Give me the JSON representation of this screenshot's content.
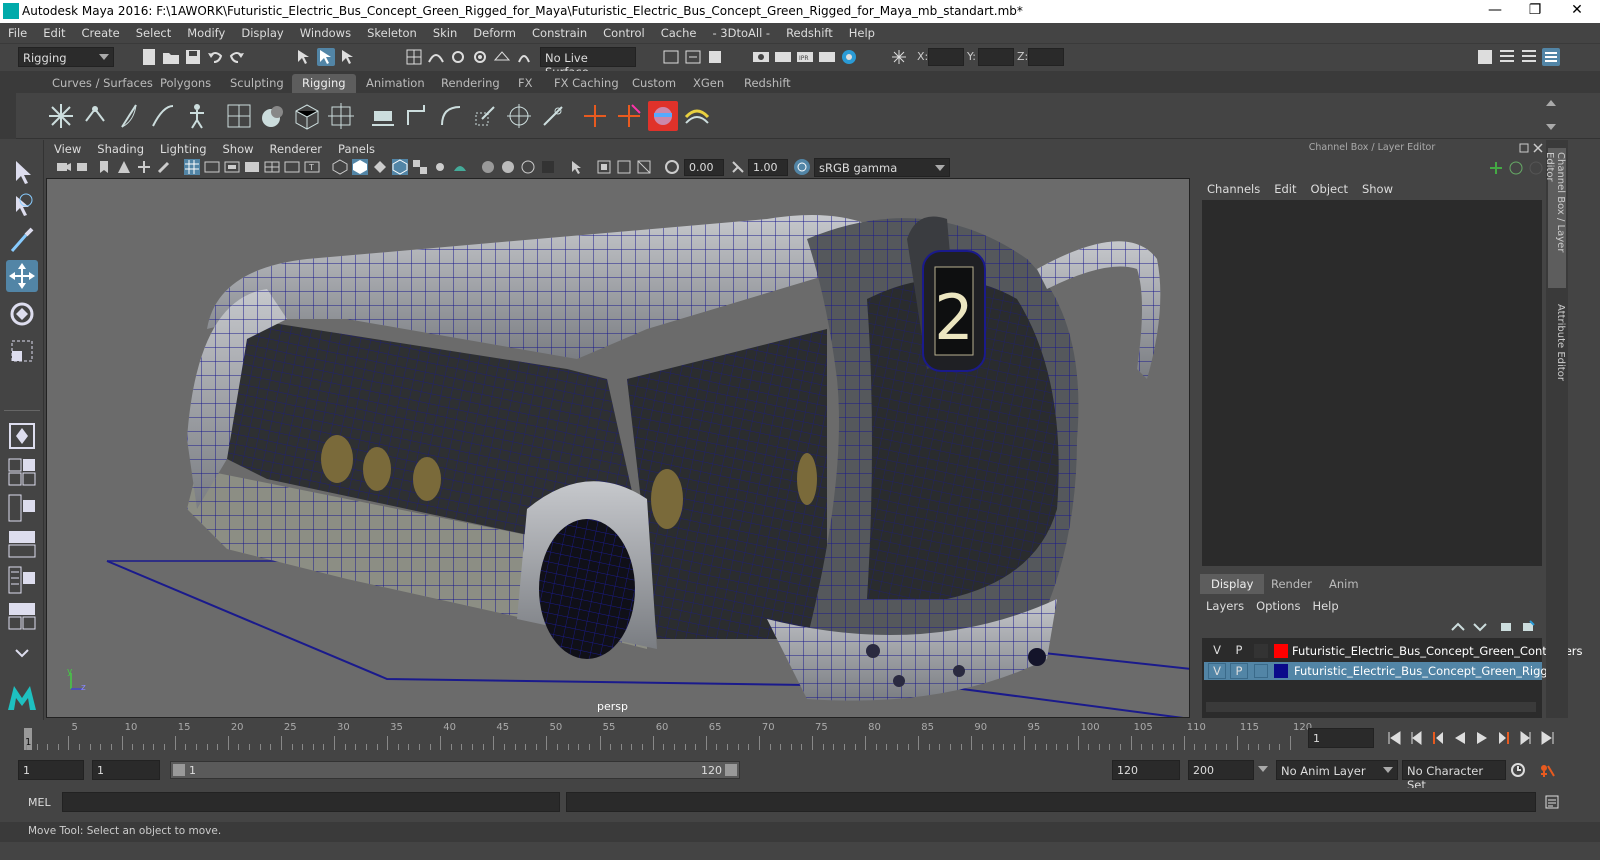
{
  "window": {
    "title": "Autodesk Maya 2016: F:\\1AWORK\\Futuristic_Electric_Bus_Concept_Green_Rigged_for_Maya\\Futuristic_Electric_Bus_Concept_Green_Rigged_for_Maya_mb_standart.mb*",
    "minimize": "—",
    "restore": "❐",
    "close": "✕"
  },
  "menubar": [
    "File",
    "Edit",
    "Create",
    "Select",
    "Modify",
    "Display",
    "Windows",
    "Skeleton",
    "Skin",
    "Deform",
    "Constrain",
    "Control",
    "Cache",
    "- 3DtoAll -",
    "Redshift",
    "Help"
  ],
  "statusline": {
    "mode": "Rigging",
    "live_surface": "No Live Surface",
    "x_label": "X:",
    "y_label": "Y:",
    "z_label": "Z:"
  },
  "shelf_tabs": [
    "Curves / Surfaces",
    "Polygons",
    "Sculpting",
    "Rigging",
    "Animation",
    "Rendering",
    "FX",
    "FX Caching",
    "Custom",
    "XGen",
    "Redshift"
  ],
  "shelf_active": "Rigging",
  "viewport": {
    "menu": [
      "View",
      "Shading",
      "Lighting",
      "Show",
      "Renderer",
      "Panels"
    ],
    "exposure": "0.00",
    "gamma": "1.00",
    "color_space": "sRGB gamma",
    "camera": "persp",
    "bus_number": "2",
    "axis_y": "y",
    "axis_z": "z"
  },
  "channel_box": {
    "title": "Channel Box / Layer Editor",
    "menu": [
      "Channels",
      "Edit",
      "Object",
      "Show"
    ],
    "layer_tabs": [
      "Display",
      "Render",
      "Anim"
    ],
    "layer_menu": [
      "Layers",
      "Options",
      "Help"
    ],
    "layers": [
      {
        "v": "V",
        "p": "P",
        "color": "#ff0000",
        "name": "Futuristic_Electric_Bus_Concept_Green_Controllers"
      },
      {
        "v": "V",
        "p": "P",
        "color": "#0a0a8a",
        "name": "Futuristic_Electric_Bus_Concept_Green_Rigged"
      }
    ],
    "side_tabs": [
      "Channel Box / Layer Editor",
      "Attribute Editor"
    ]
  },
  "timeline": {
    "ticks": [
      5,
      10,
      15,
      20,
      25,
      30,
      35,
      40,
      45,
      50,
      55,
      60,
      65,
      70,
      75,
      80,
      85,
      90,
      95,
      100,
      105,
      110,
      115,
      120
    ],
    "current_frame_marker": "1",
    "current_frame": "1"
  },
  "range": {
    "start": "1",
    "playback_start": "1",
    "range_start_label": "1",
    "range_end_label": "120",
    "playback_end": "120",
    "end": "200",
    "anim_layer": "No Anim Layer",
    "character_set": "No Character Set"
  },
  "command": {
    "label": "MEL"
  },
  "help_line": "Move Tool: Select an object to move.",
  "colors": {
    "accent": "#5285a6",
    "wire": "#1a1a8c"
  }
}
